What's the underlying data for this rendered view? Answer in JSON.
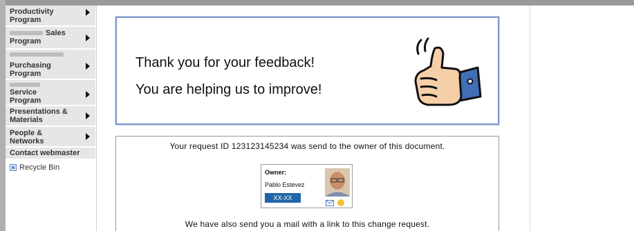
{
  "sidebar": {
    "items": [
      {
        "label": "Productivity\nProgram",
        "has_arrow": true
      },
      {
        "label": "Sales\nProgram",
        "has_arrow": true
      },
      {
        "label": "Purchasing\nProgram",
        "has_arrow": true
      },
      {
        "label": "Service\nProgram",
        "has_arrow": true
      },
      {
        "label": "Presentations &\nMaterials",
        "has_arrow": true
      },
      {
        "label": "People &\nNetworks",
        "has_arrow": true
      }
    ],
    "contact_label": "Contact webmaster",
    "recycle_label": "Recycle Bin"
  },
  "feedback": {
    "line1": "Thank you for your feedback!",
    "line2": "You are helping us to improve!",
    "icon": "thumbs-up-icon"
  },
  "request": {
    "line1": "Your request ID 123123145234  was send to the owner of this document.",
    "line2": "We have also send you a mail with a link  to this change request."
  },
  "owner": {
    "title": "Owner:",
    "name": "Pablo Estevez",
    "dept": "XX-XX",
    "status_color": "#f2c12e"
  },
  "colors": {
    "accent_border": "#7f98c9",
    "dept_badge": "#1f66a8",
    "nav_bg": "#e6e6e6"
  }
}
